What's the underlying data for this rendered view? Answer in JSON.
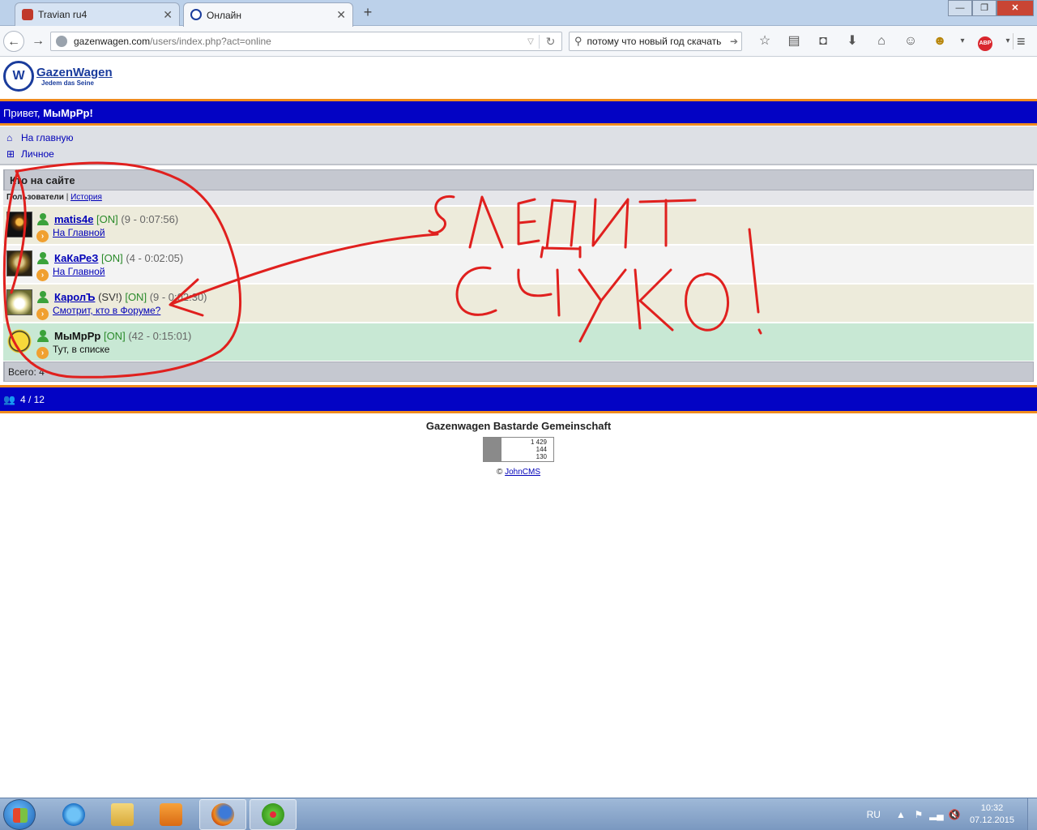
{
  "browser": {
    "tabs": [
      {
        "label": "Travian ru4",
        "active": false
      },
      {
        "label": "Онлайн",
        "active": true
      }
    ],
    "url_domain": "gazenwagen.com",
    "url_path": "/users/index.php?act=online",
    "search_value": "потому что новый год скачать",
    "window_buttons": {
      "minimize": "—",
      "maximize": "❐",
      "close": "✕"
    }
  },
  "site": {
    "logo_name": "GazenWagen",
    "logo_slogan": "Jedem das Seine",
    "greeting_prefix": "Привет, ",
    "greeting_user": "МыМрРр!",
    "menu": [
      {
        "label": "На главную",
        "icon": "home-icon"
      },
      {
        "label": "Личное",
        "icon": "grid-icon"
      }
    ],
    "list_title": "Кто на сайте",
    "subtabs": {
      "current": "Пользователи",
      "separator": " | ",
      "history": "История"
    },
    "users": [
      {
        "name": "matis4e",
        "extra": "",
        "status": "[ON]",
        "time": "(9 - 0:07:56)",
        "action": "На Главной",
        "self": false
      },
      {
        "name": "КаКаРеЗ",
        "extra": "",
        "status": "[ON]",
        "time": "(4 - 0:02:05)",
        "action": "На Главной",
        "self": false
      },
      {
        "name": "КаролЪ",
        "extra": "(SV!)",
        "status": "[ON]",
        "time": "(9 - 0:02:30)",
        "action": "Смотрит, кто в Форуме?",
        "self": false
      },
      {
        "name": "МыМрРр",
        "extra": "",
        "status": "[ON]",
        "time": "(42 - 0:15:01)",
        "action": "Тут, в списке",
        "self": true
      }
    ],
    "total": "Всего: 4",
    "online_count": "4 / 12",
    "footer_title": "Gazenwagen Bastarde Gemeinschaft",
    "counter": [
      "1 429",
      "144",
      "130"
    ],
    "powered_prefix": "© ",
    "powered_link": "JohnCMS"
  },
  "annotation": {
    "colors": {
      "ink": "#e0201e"
    },
    "line1": "СЛЕДИТ",
    "line2": "СЧУКО!"
  },
  "taskbar": {
    "lang": "RU",
    "time": "10:32",
    "date": "07.12.2015"
  },
  "colors": {
    "brand_blue": "#0303c4",
    "accent_orange": "#f08c1e",
    "link": "#0000b8",
    "online_green": "#2a8a2a"
  }
}
